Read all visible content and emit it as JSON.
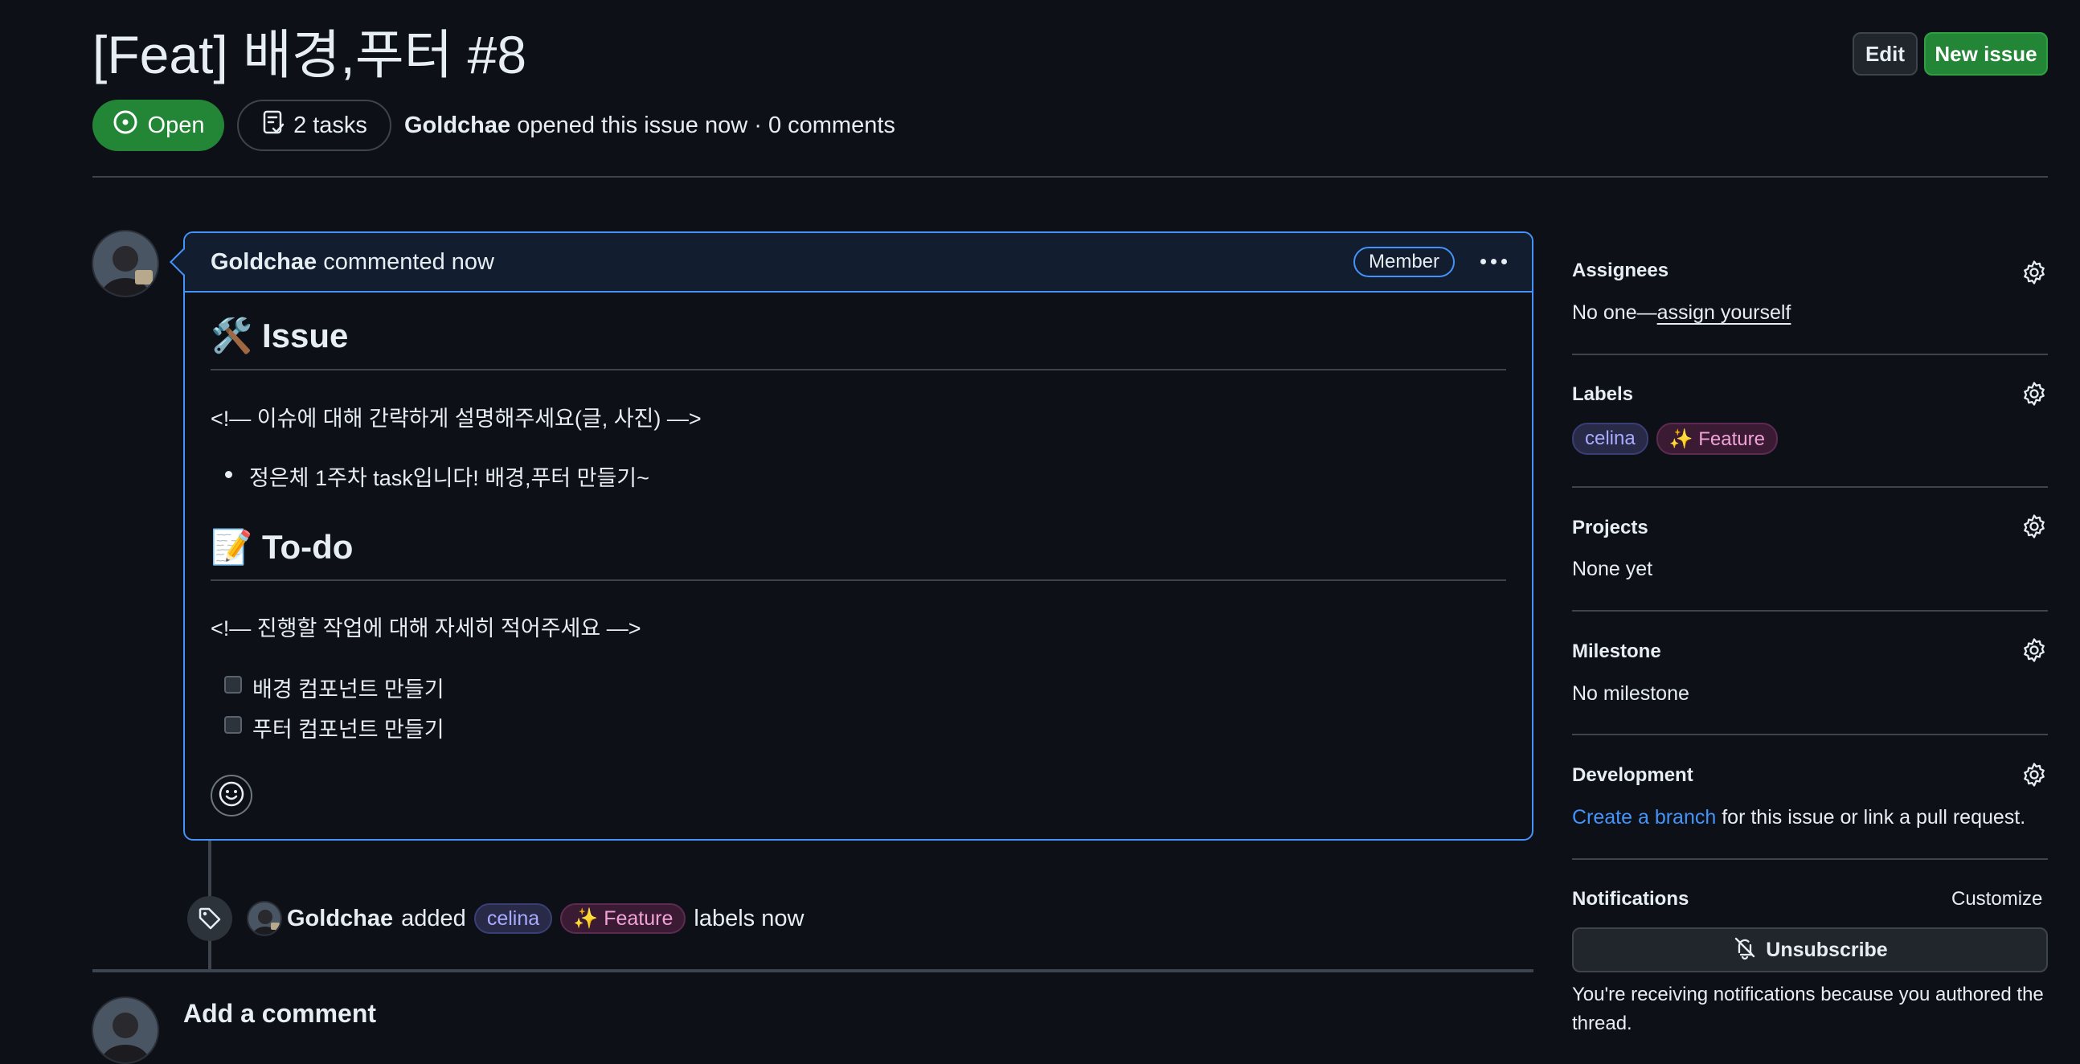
{
  "issue": {
    "title": "[Feat] 배경,푸터 #8",
    "state": "Open",
    "tasks": "2 tasks",
    "author": "Goldchae",
    "meta_rest": "opened this issue now · 0 comments"
  },
  "actions": {
    "edit": "Edit",
    "new_issue": "New issue"
  },
  "comment": {
    "author": "Goldchae",
    "time": "commented now",
    "role_badge": "Member",
    "issue_heading": "🛠️ Issue",
    "issue_comment": "<!— 이슈에 대해 간략하게 설명해주세요(글, 사진) —>",
    "issue_bullet": "정은체 1주차 task입니다! 배경,푸터 만들기~",
    "todo_heading": "📝 To-do",
    "todo_comment": "<!— 진행할 작업에 대해 자세히 적어주세요 —>",
    "todo_items": [
      "배경 컴포넌트 만들기",
      "푸터 컴포넌트 만들기"
    ]
  },
  "timeline": {
    "author": "Goldchae",
    "action": "added",
    "labels": [
      "celina",
      "✨ Feature"
    ],
    "suffix": "labels now"
  },
  "add_comment": {
    "heading": "Add a comment"
  },
  "sidebar": {
    "assignees": {
      "heading": "Assignees",
      "prefix": "No one—",
      "link": "assign yourself"
    },
    "labels": {
      "heading": "Labels",
      "items": [
        "celina",
        "✨ Feature"
      ]
    },
    "projects": {
      "heading": "Projects",
      "value": "None yet"
    },
    "milestone": {
      "heading": "Milestone",
      "value": "No milestone"
    },
    "development": {
      "heading": "Development",
      "link": "Create a branch",
      "suffix": " for this issue or link a pull request."
    },
    "notifications": {
      "heading": "Notifications",
      "customize": "Customize",
      "unsubscribe": "Unsubscribe",
      "info": "You're receiving notifications because you authored the thread."
    }
  },
  "colors": {
    "background": "#0d1117",
    "open_green": "#238636",
    "accent_blue": "#4493f8",
    "label_celina": "#a9abff",
    "label_feature": "#f1a3d8"
  }
}
